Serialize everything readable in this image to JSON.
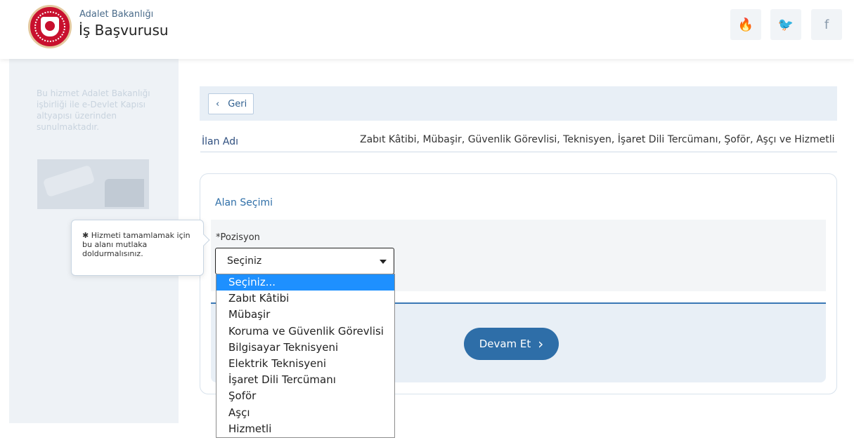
{
  "header": {
    "org": "Adalet Bakanlığı",
    "title": "İş Başvurusu",
    "social": [
      {
        "icon": "fire-icon",
        "glyph": "🔥"
      },
      {
        "icon": "twitter-icon",
        "glyph": "🐦"
      },
      {
        "icon": "facebook-icon",
        "glyph": "f"
      }
    ]
  },
  "sidebar": {
    "notice": "Bu hizmet Adalet Bakanlığı işbirliği ile e-Devlet Kapısı altyapısı üzerinden sunulmaktadır."
  },
  "tooltip": {
    "text": "✱ Hizmeti tamamlamak için bu alanı mutlaka doldurmalısınız."
  },
  "main": {
    "back_label": "Geri",
    "back_icon": "‹",
    "ilan_label": "İlan Adı",
    "ilan_value": "Zabıt Kâtibi, Mübaşir, Güvenlik Görevlisi, Teknisyen, İşaret Dili Tercümanı, Şoför, Aşçı ve Hizmetli",
    "section_title": "Alan Seçimi",
    "field_label": "*Pozisyon",
    "select_value": "Seçiniz",
    "continue_label": "Devam Et",
    "continue_icon": "›"
  },
  "dropdown": {
    "options": [
      "Seçiniz...",
      "Zabıt Kâtibi",
      "Mübaşir",
      "Koruma ve Güvenlik Görevlisi",
      "Bilgisayar Teknisyeni",
      "Elektrik Teknisyeni",
      "İşaret Dili Tercümanı",
      "Şoför",
      "Aşçı",
      "Hizmetli"
    ],
    "highlighted": "Seçiniz..."
  },
  "colors": {
    "accent": "#2e6ea8",
    "highlight": "#1e90ff",
    "logo_red": "#c8102e"
  }
}
